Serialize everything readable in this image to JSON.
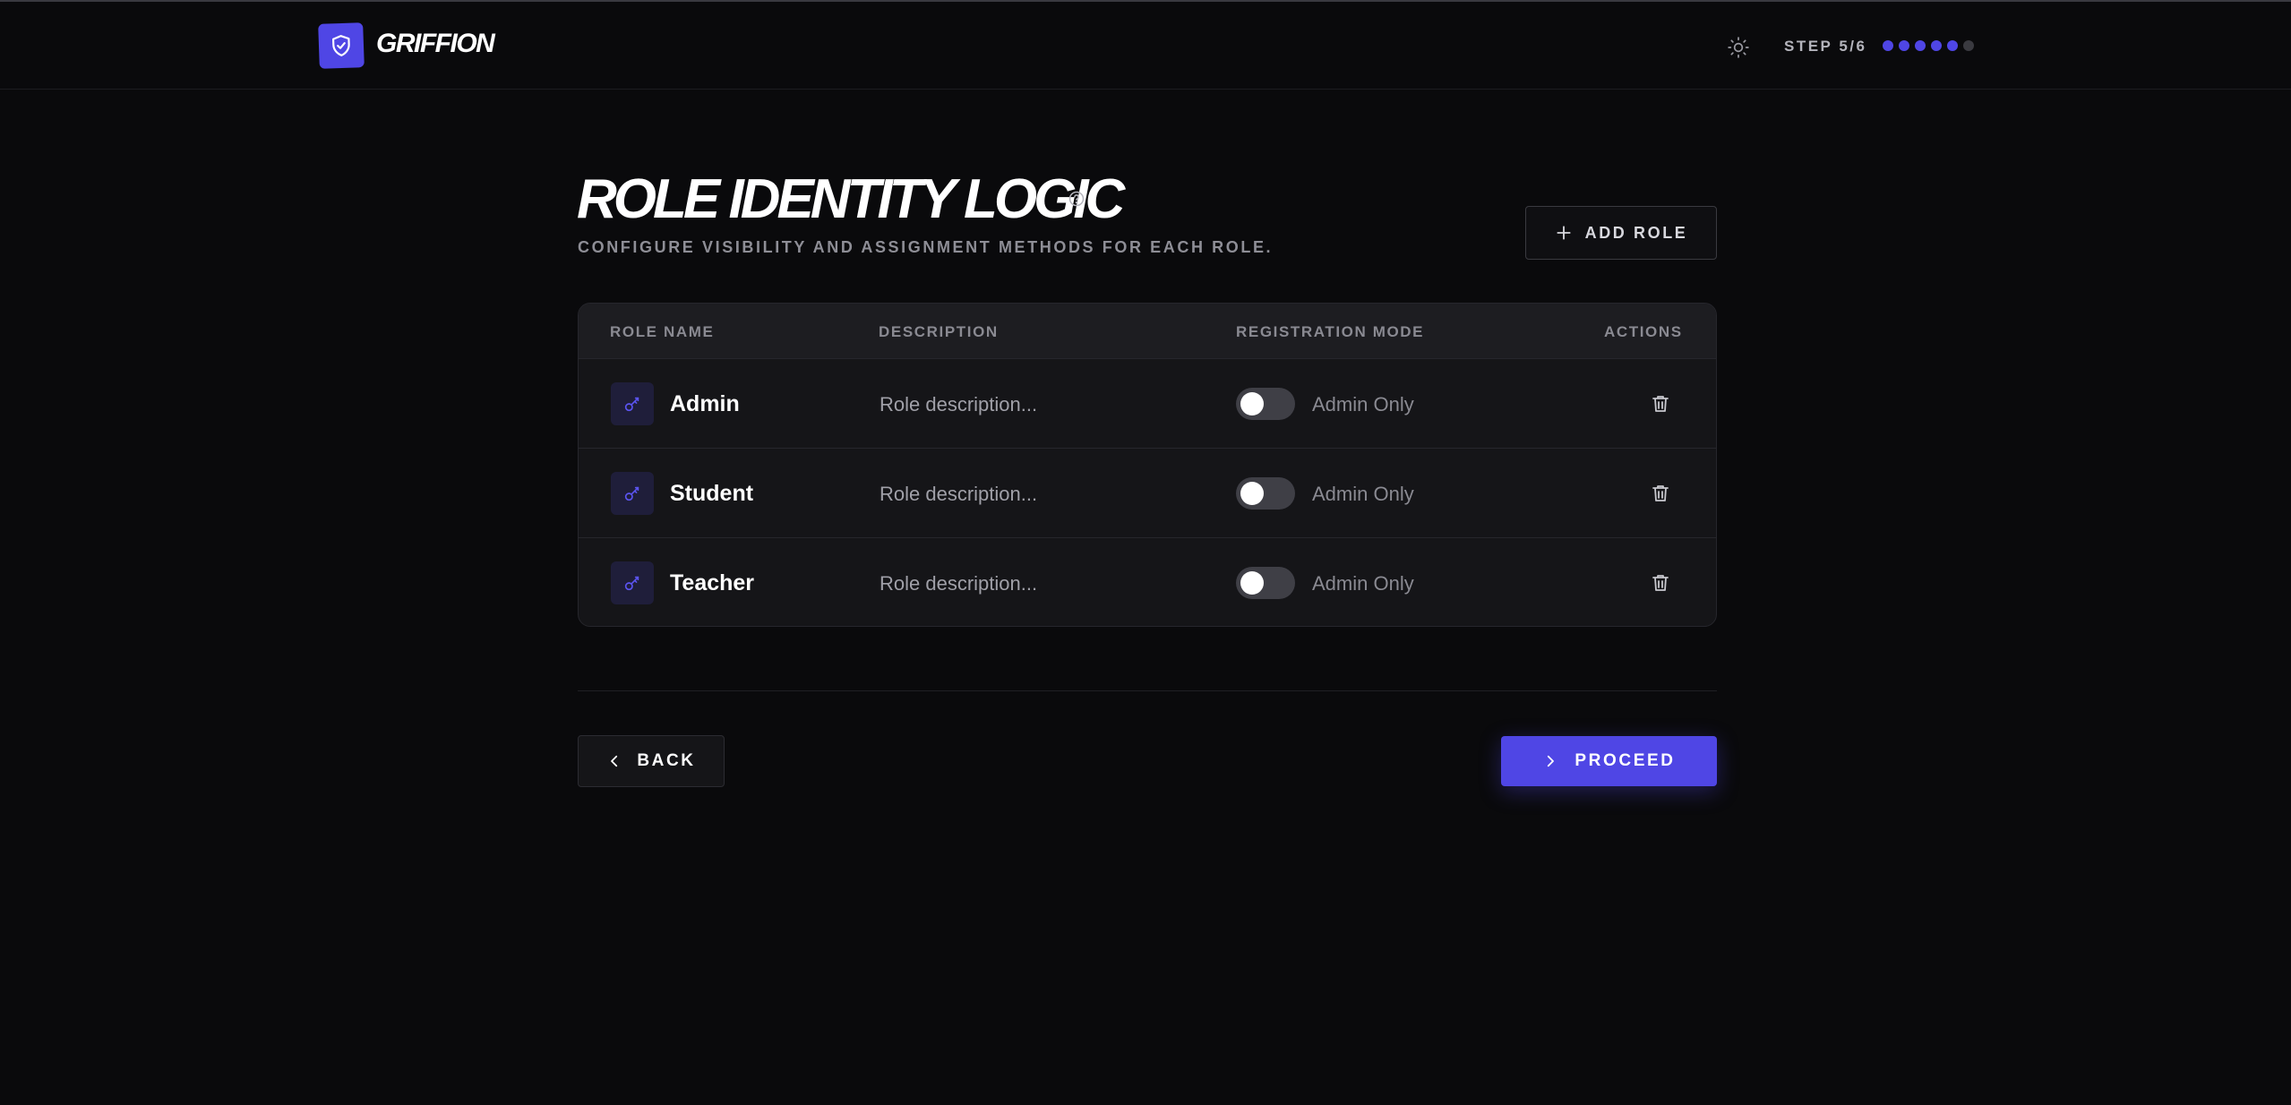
{
  "brand": {
    "name": "GRIFFION",
    "logo_icon": "shield-check-icon",
    "accent_color": "#4f46e5"
  },
  "header": {
    "theme_icon": "sun-icon",
    "step_label": "STEP 5/6",
    "steps_total": 6,
    "steps_completed": 5
  },
  "page": {
    "title": "ROLE IDENTITY LOGIC",
    "help_icon": "question-circle-icon",
    "subtitle": "CONFIGURE VISIBILITY AND ASSIGNMENT METHODS FOR EACH ROLE.",
    "add_role_label": "ADD ROLE"
  },
  "table": {
    "columns": [
      "ROLE NAME",
      "DESCRIPTION",
      "REGISTRATION MODE",
      "ACTIONS"
    ],
    "rows": [
      {
        "name": "Admin",
        "description": "Role description...",
        "registration_mode": "Admin Only",
        "toggle_on": false,
        "icon": "key-icon"
      },
      {
        "name": "Student",
        "description": "Role description...",
        "registration_mode": "Admin Only",
        "toggle_on": false,
        "icon": "key-icon"
      },
      {
        "name": "Teacher",
        "description": "Role description...",
        "registration_mode": "Admin Only",
        "toggle_on": false,
        "icon": "key-icon"
      }
    ]
  },
  "footer": {
    "back_label": "BACK",
    "proceed_label": "PROCEED"
  }
}
